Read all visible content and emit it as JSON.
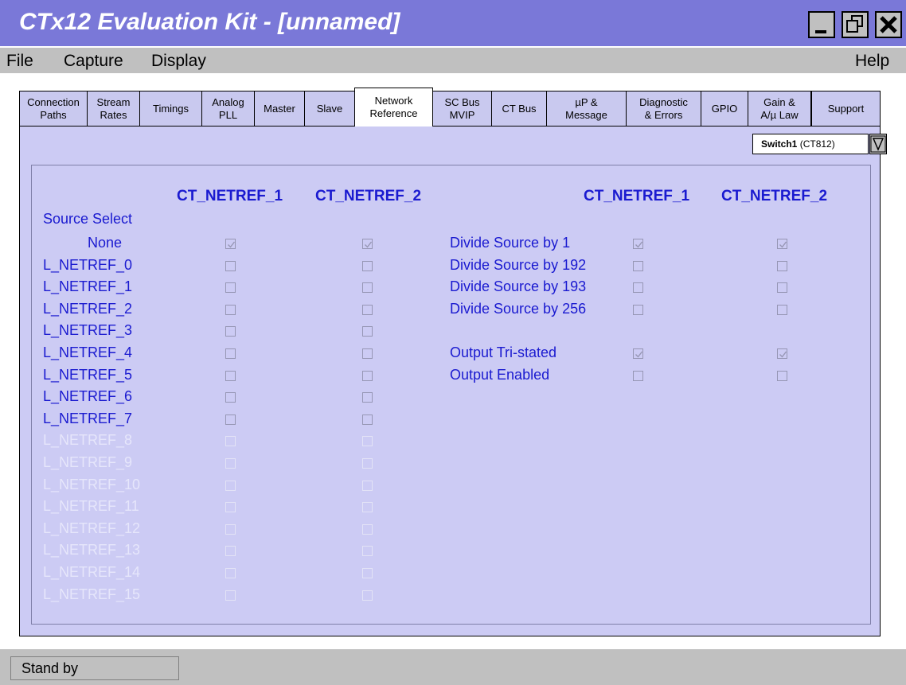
{
  "window": {
    "title": "CTx12 Evaluation Kit - [unnamed]"
  },
  "menu": {
    "file": "File",
    "capture": "Capture",
    "display": "Display",
    "help": "Help"
  },
  "tabs": [
    {
      "label": "Connection\nPaths"
    },
    {
      "label": "Stream\nRates"
    },
    {
      "label": "Timings"
    },
    {
      "label": "Analog\nPLL"
    },
    {
      "label": "Master"
    },
    {
      "label": "Slave"
    },
    {
      "label": "Network\nReference",
      "active": true
    },
    {
      "label": "SC Bus\nMVIP"
    },
    {
      "label": "CT Bus"
    },
    {
      "label": "µP &\nMessage"
    },
    {
      "label": "Diagnostic\n& Errors"
    },
    {
      "label": "GPIO"
    },
    {
      "label": "Gain &\nA/µ Law"
    },
    {
      "label": "Support"
    }
  ],
  "device_select": {
    "name": "Switch1",
    "model": "(CT812)"
  },
  "columns": {
    "left_1": "CT_NETREF_1",
    "left_2": "CT_NETREF_2",
    "right_1": "CT_NETREF_1",
    "right_2": "CT_NETREF_2"
  },
  "source_select_label": "Source Select",
  "sources": [
    {
      "label": "None",
      "ct1": true,
      "ct2": true,
      "enabled": true
    },
    {
      "label": "L_NETREF_0",
      "ct1": false,
      "ct2": false,
      "enabled": true
    },
    {
      "label": "L_NETREF_1",
      "ct1": false,
      "ct2": false,
      "enabled": true
    },
    {
      "label": "L_NETREF_2",
      "ct1": false,
      "ct2": false,
      "enabled": true
    },
    {
      "label": "L_NETREF_3",
      "ct1": false,
      "ct2": false,
      "enabled": true
    },
    {
      "label": "L_NETREF_4",
      "ct1": false,
      "ct2": false,
      "enabled": true
    },
    {
      "label": "L_NETREF_5",
      "ct1": false,
      "ct2": false,
      "enabled": true
    },
    {
      "label": "L_NETREF_6",
      "ct1": false,
      "ct2": false,
      "enabled": true
    },
    {
      "label": "L_NETREF_7",
      "ct1": false,
      "ct2": false,
      "enabled": true
    },
    {
      "label": "L_NETREF_8",
      "ct1": false,
      "ct2": false,
      "enabled": false
    },
    {
      "label": "L_NETREF_9",
      "ct1": false,
      "ct2": false,
      "enabled": false
    },
    {
      "label": "L_NETREF_10",
      "ct1": false,
      "ct2": false,
      "enabled": false
    },
    {
      "label": "L_NETREF_11",
      "ct1": false,
      "ct2": false,
      "enabled": false
    },
    {
      "label": "L_NETREF_12",
      "ct1": false,
      "ct2": false,
      "enabled": false
    },
    {
      "label": "L_NETREF_13",
      "ct1": false,
      "ct2": false,
      "enabled": false
    },
    {
      "label": "L_NETREF_14",
      "ct1": false,
      "ct2": false,
      "enabled": false
    },
    {
      "label": "L_NETREF_15",
      "ct1": false,
      "ct2": false,
      "enabled": false
    }
  ],
  "divide": [
    {
      "label": "Divide Source by 1",
      "ct1": true,
      "ct2": true
    },
    {
      "label": "Divide Source by 192",
      "ct1": false,
      "ct2": false
    },
    {
      "label": "Divide Source by 193",
      "ct1": false,
      "ct2": false
    },
    {
      "label": "Divide Source by 256",
      "ct1": false,
      "ct2": false
    }
  ],
  "output": [
    {
      "label": "Output Tri-stated",
      "ct1": true,
      "ct2": true
    },
    {
      "label": "Output Enabled",
      "ct1": false,
      "ct2": false
    }
  ],
  "status": {
    "text": "Stand by"
  }
}
